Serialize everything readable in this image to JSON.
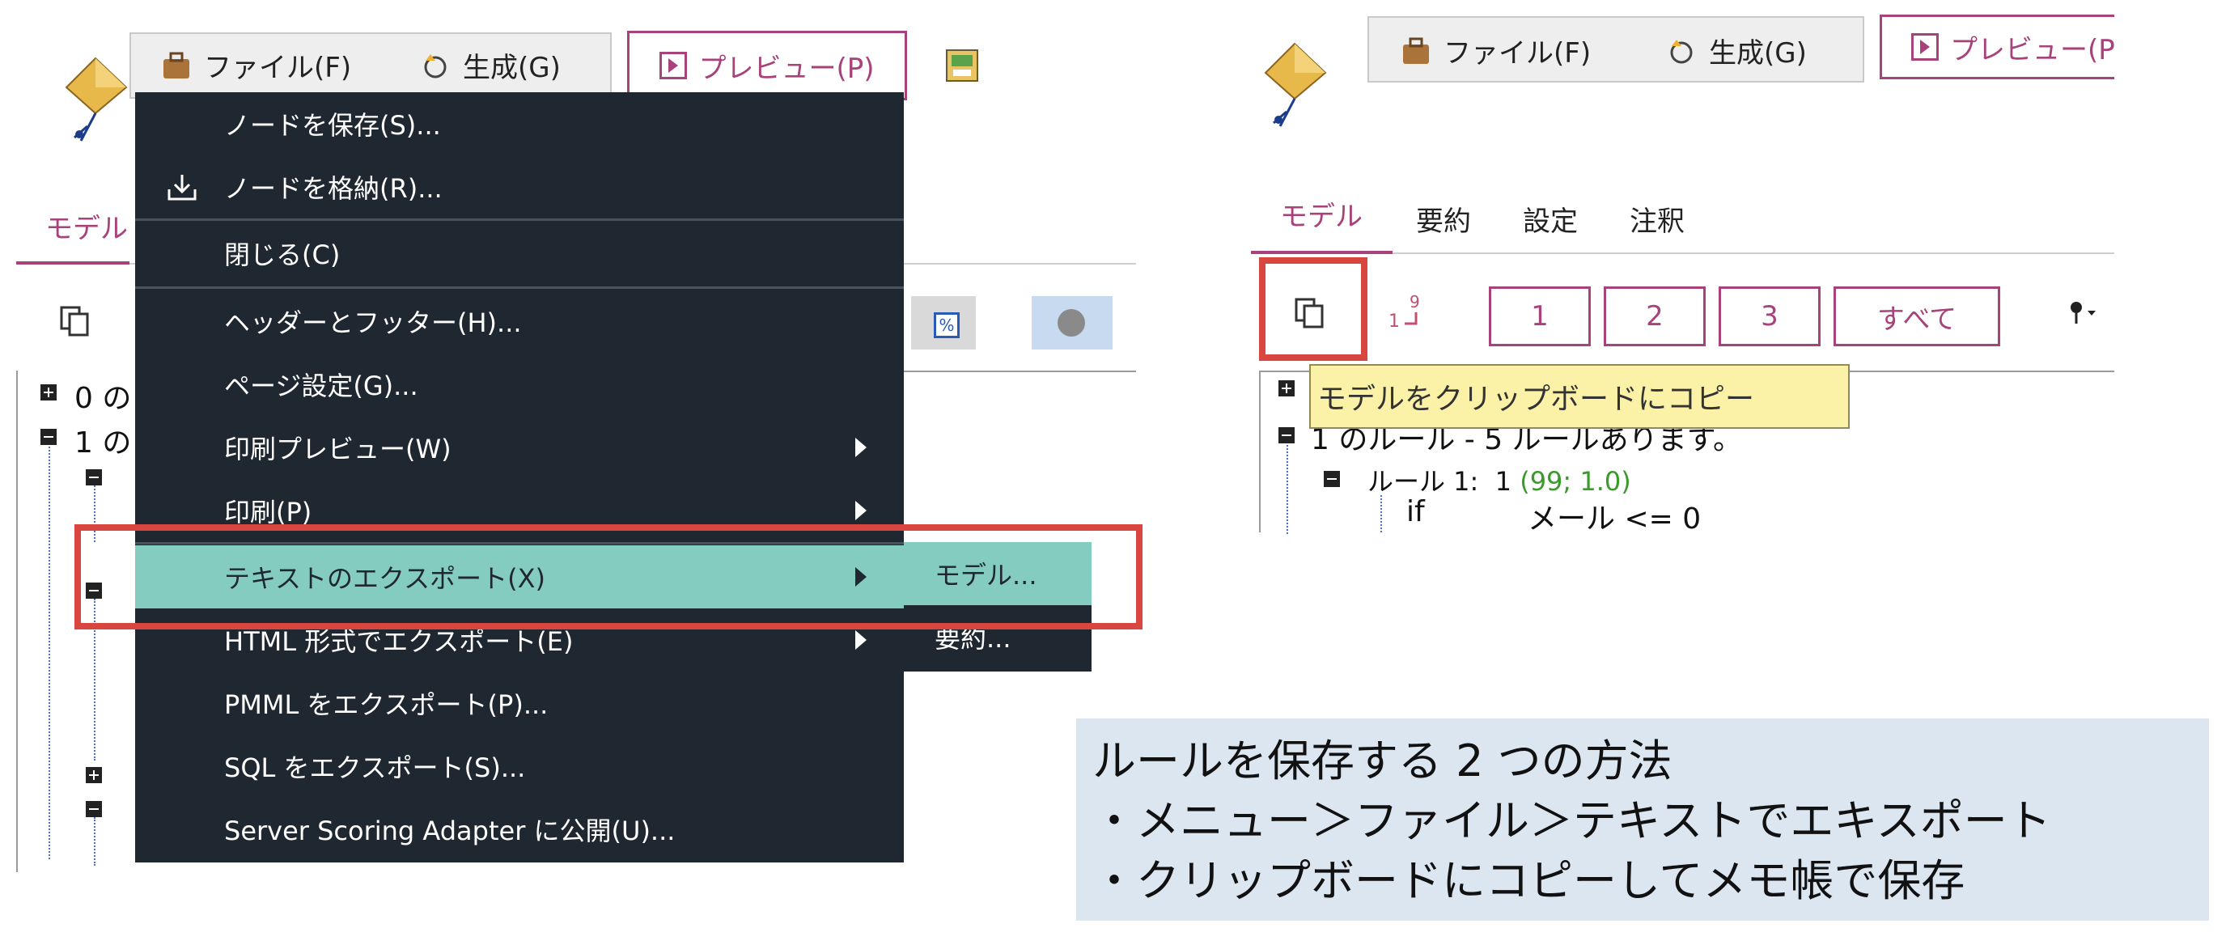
{
  "left": {
    "toolbar": {
      "file": "ファイル(F)",
      "generate": "生成(G)",
      "preview": "プレビュー(P)"
    },
    "tab_model_partial": "モデル",
    "tree": [
      "0 の",
      "1 の"
    ]
  },
  "menu": {
    "items": [
      {
        "label": "ノードを保存(S)...",
        "icon": ""
      },
      {
        "label": "ノードを格納(R)...",
        "icon": "download-tray-icon"
      },
      {
        "label": "閉じる(C)",
        "icon": ""
      },
      {
        "label": "ヘッダーとフッター(H)...",
        "icon": ""
      },
      {
        "label": "ページ設定(G)...",
        "icon": ""
      },
      {
        "label": "印刷プレビュー(W)",
        "icon": "",
        "submenu": true
      },
      {
        "label": "印刷(P)",
        "icon": "",
        "submenu": true
      },
      {
        "label": "テキストのエクスポート(X)",
        "icon": "",
        "submenu": true,
        "highlighted": true
      },
      {
        "label": "HTML 形式でエクスポート(E)",
        "icon": "",
        "submenu": true
      },
      {
        "label": "PMML をエクスポート(P)...",
        "icon": ""
      },
      {
        "label": "SQL をエクスポート(S)...",
        "icon": ""
      },
      {
        "label": "Server Scoring Adapter に公開(U)...",
        "icon": ""
      }
    ],
    "submenu": [
      "モデル...",
      "要約..."
    ]
  },
  "right": {
    "toolbar": {
      "file": "ファイル(F)",
      "generate": "生成(G)",
      "preview": "プレビュー(P)"
    },
    "tabs": [
      "モデル",
      "要約",
      "設定",
      "注釈"
    ],
    "buttons": [
      "1",
      "2",
      "3",
      "すべて"
    ],
    "tooltip": "モデルをクリップボードにコピー",
    "tree": {
      "line1": "1 のルール - 5 ルールあります。",
      "rule_label": "ルール 1:",
      "rule_value": "1",
      "rule_stats": "(99; 1.0)",
      "if_kw": "if",
      "condition": "メール <= 0"
    }
  },
  "note": {
    "line1": "ルールを保存する 2 つの方法",
    "line2": "・メニュー＞ファイル＞テキストでエキスポート",
    "line3": "・クリップボードにコピーしてメモ帳で保存"
  },
  "colors": {
    "menu_bg": "#1f2730",
    "highlight": "#84ccbf",
    "accent": "#a8427a",
    "red": "#d9463f",
    "tooltip": "#fbf2a8",
    "note_bg": "#dce6f1",
    "green": "#3a9a2a"
  }
}
